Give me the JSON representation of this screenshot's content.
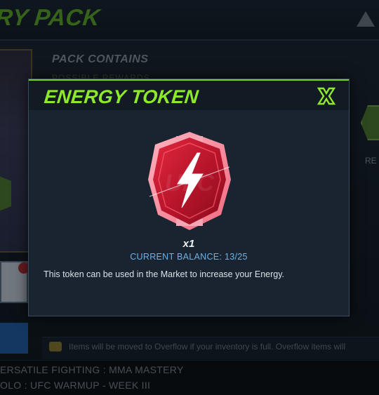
{
  "background": {
    "screen_title": "RY PACK",
    "pack_contains_label": "PACK CONTAINS",
    "pack_sub_label": "POSSIBLE REWARDS",
    "right_label": "RE",
    "overflow_notice": "Items will be moved to Overflow if your inventory is full. Overflow items will",
    "objective_1": "ERSATILE FIGHTING : MMA MASTERY",
    "objective_2": "OLO : UFC WARMUP - WEEK III"
  },
  "modal": {
    "title": "ENERGY TOKEN",
    "close_icon": "close-x-icon",
    "token_icon": "energy-bolt-icon",
    "quantity": "x1",
    "balance": "CURRENT BALANCE: 13/25",
    "description": "This token can be used in the Market to increase your Energy."
  },
  "colors": {
    "accent_green": "#8ee92a",
    "balance_blue": "#6cb2e6",
    "token_red": "#c61a2e",
    "modal_bg": "#1a2330"
  }
}
